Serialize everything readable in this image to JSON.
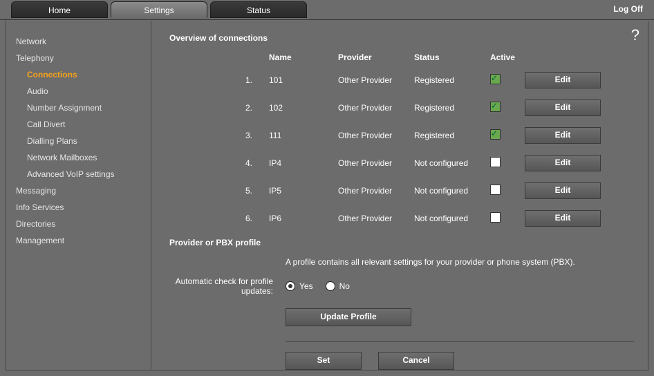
{
  "tabs": {
    "home": "Home",
    "settings": "Settings",
    "status": "Status"
  },
  "logoff_label": "Log Off",
  "help_icon": "?",
  "sidebar": {
    "network": "Network",
    "telephony": "Telephony",
    "connections": "Connections",
    "audio": "Audio",
    "number_assignment": "Number Assignment",
    "call_divert": "Call Divert",
    "dialling_plans": "Dialling Plans",
    "network_mailboxes": "Network Mailboxes",
    "advanced_voip": "Advanced VoIP settings",
    "messaging": "Messaging",
    "info_services": "Info Services",
    "directories": "Directories",
    "management": "Management"
  },
  "overview": {
    "title": "Overview of connections",
    "headers": {
      "name": "Name",
      "provider": "Provider",
      "status": "Status",
      "active": "Active"
    },
    "edit_label": "Edit",
    "rows": [
      {
        "idx": "1.",
        "name": "101",
        "provider": "Other Provider",
        "status": "Registered",
        "active": true
      },
      {
        "idx": "2.",
        "name": "102",
        "provider": "Other Provider",
        "status": "Registered",
        "active": true
      },
      {
        "idx": "3.",
        "name": "111",
        "provider": "Other Provider",
        "status": "Registered",
        "active": true
      },
      {
        "idx": "4.",
        "name": "IP4",
        "provider": "Other Provider",
        "status": "Not configured",
        "active": false
      },
      {
        "idx": "5.",
        "name": "IP5",
        "provider": "Other Provider",
        "status": "Not configured",
        "active": false
      },
      {
        "idx": "6.",
        "name": "IP6",
        "provider": "Other Provider",
        "status": "Not configured",
        "active": false
      }
    ]
  },
  "profile": {
    "title": "Provider or PBX profile",
    "description": "A profile contains all relevant settings for your provider or phone system (PBX).",
    "auto_check_label": "Automatic check for profile updates:",
    "yes": "Yes",
    "no": "No",
    "auto_check_value": "yes",
    "update_btn": "Update Profile"
  },
  "buttons": {
    "set": "Set",
    "cancel": "Cancel"
  }
}
